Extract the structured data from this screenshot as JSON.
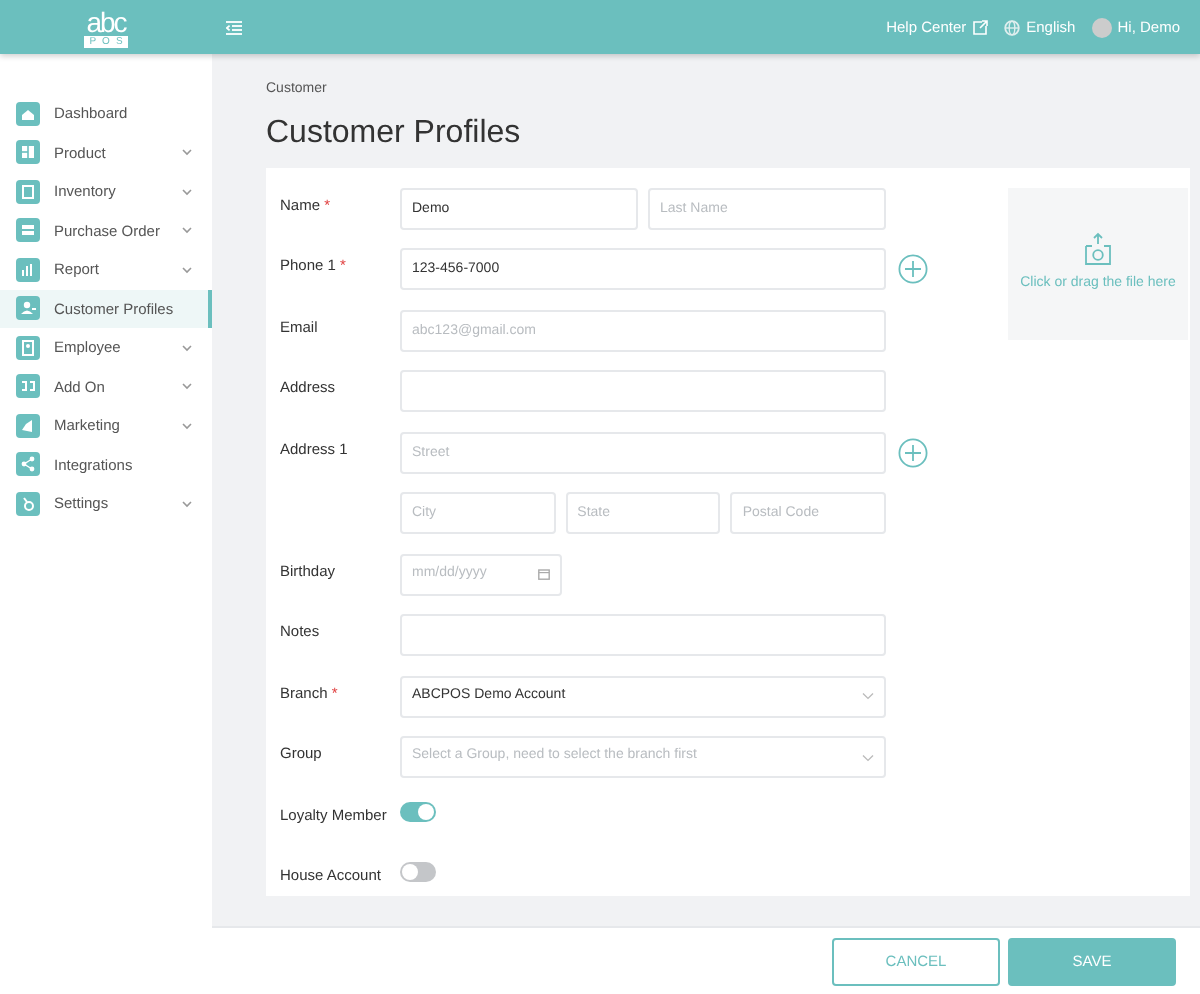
{
  "header": {
    "logo_top": "abc",
    "logo_bottom": "POS",
    "links": [
      {
        "kind": "help",
        "label": "Help Center"
      },
      {
        "kind": "language",
        "label": "English"
      },
      {
        "kind": "user",
        "label": "Hi, Demo"
      }
    ]
  },
  "sidebar": {
    "items": [
      {
        "label": "Dashboard",
        "expandable": false,
        "selected": false
      },
      {
        "label": "Product",
        "expandable": true,
        "selected": false
      },
      {
        "label": "Inventory",
        "expandable": true,
        "selected": false
      },
      {
        "label": "Purchase Order",
        "expandable": true,
        "selected": false
      },
      {
        "label": "Report",
        "expandable": true,
        "selected": false
      },
      {
        "label": "Customer Profiles",
        "expandable": false,
        "selected": true
      },
      {
        "label": "Employee",
        "expandable": true,
        "selected": false
      },
      {
        "label": "Add On",
        "expandable": true,
        "selected": false
      },
      {
        "label": "Marketing",
        "expandable": true,
        "selected": false
      },
      {
        "label": "Integrations",
        "expandable": false,
        "selected": false
      },
      {
        "label": "Settings",
        "expandable": true,
        "selected": false
      }
    ]
  },
  "breadcrumb": "Customer",
  "title": "Customer Profiles",
  "form": {
    "rows": [
      {
        "label": "Name",
        "required_mark": "*",
        "kind": "text",
        "addable": false,
        "fields": [
          {
            "kind": "input",
            "value": "Demo"
          },
          {
            "kind": "input",
            "placeholder": "Last Name"
          }
        ]
      },
      {
        "label": "Phone 1",
        "required_mark": "*",
        "kind": "text",
        "addable": true,
        "fields": [
          {
            "kind": "input",
            "value": "123-456-7000"
          }
        ]
      },
      {
        "label": "Email",
        "kind": "text",
        "addable": false,
        "fields": [
          {
            "kind": "input",
            "placeholder": "abc123@gmail.com"
          }
        ]
      },
      {
        "label": "Address",
        "kind": "text",
        "addable": false,
        "fields": [
          {
            "kind": "input"
          }
        ]
      },
      {
        "label": "Address 1",
        "kind": "text",
        "addable": true,
        "fields": [
          {
            "kind": "input",
            "placeholder": "Street"
          }
        ]
      },
      {
        "kind": "text",
        "addable": false,
        "fields": [
          {
            "kind": "input",
            "placeholder": "City"
          },
          {
            "kind": "input",
            "placeholder": "State"
          },
          {
            "kind": "input",
            "placeholder": "Postal Code"
          }
        ]
      },
      {
        "label": "Birthday",
        "kind": "date",
        "addable": false,
        "fields": [
          {
            "kind": "input",
            "placeholder": "mm/dd/yyyy"
          }
        ]
      },
      {
        "label": "Notes",
        "kind": "text",
        "addable": false,
        "fields": [
          {
            "kind": "input"
          }
        ]
      },
      {
        "label": "Branch",
        "required_mark": "*",
        "kind": "select",
        "addable": false,
        "fields": [
          {
            "kind": "input",
            "value": "ABCPOS Demo Account"
          }
        ]
      },
      {
        "label": "Group",
        "kind": "select",
        "addable": false,
        "fields": [
          {
            "kind": "input",
            "placeholder": "Select a Group, need to select the branch first"
          }
        ]
      },
      {
        "label": "Loyalty Member",
        "kind": "toggle",
        "on": true
      },
      {
        "label": "House Account",
        "kind": "toggle",
        "on": false
      }
    ]
  },
  "upload": {
    "label": "Click or drag the file here"
  },
  "buttons": [
    {
      "kind": "cancel",
      "label": "CANCEL"
    },
    {
      "kind": "save",
      "label": "SAVE"
    }
  ]
}
